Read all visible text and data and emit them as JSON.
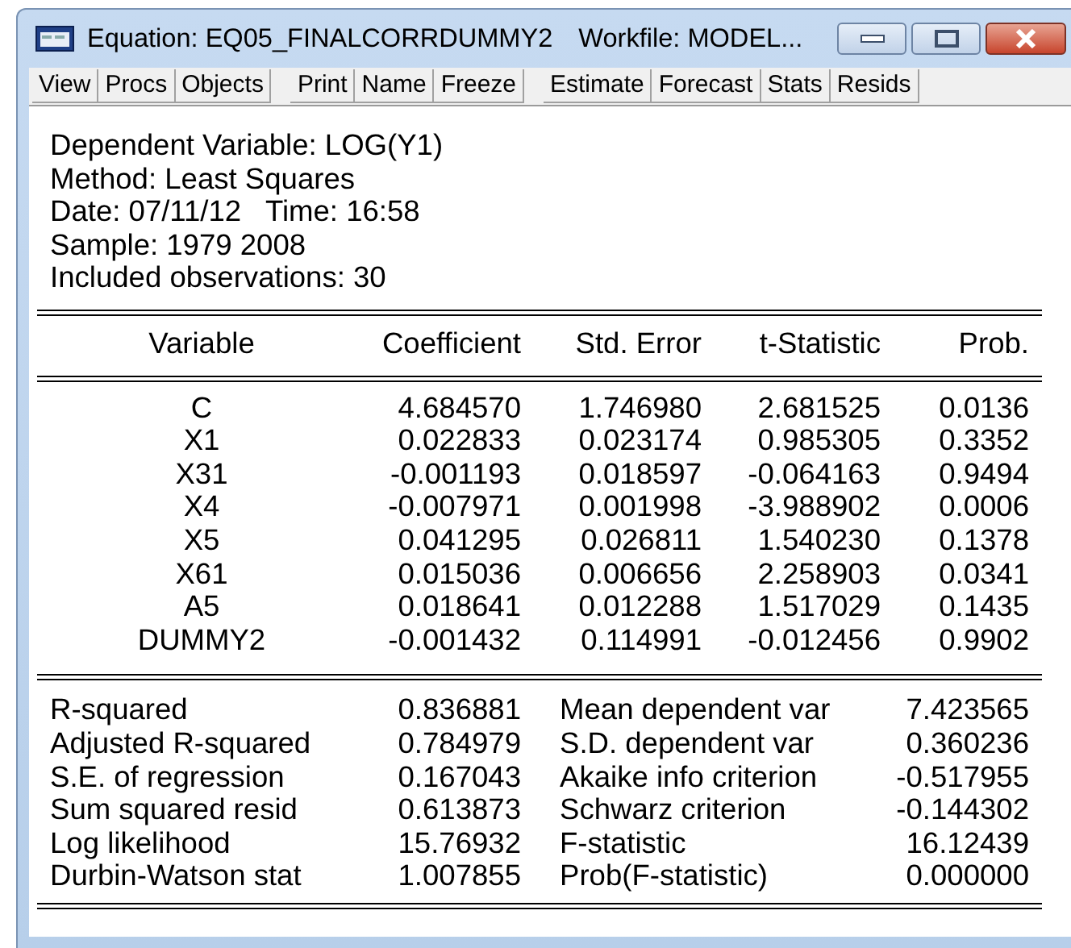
{
  "window": {
    "title": "Equation: EQ05_FINALCORRDUMMY2",
    "workfile": "Workfile: MODEL..."
  },
  "toolbar": [
    [
      "View",
      "Procs",
      "Objects"
    ],
    [
      "Print",
      "Name",
      "Freeze"
    ],
    [
      "Estimate",
      "Forecast",
      "Stats",
      "Resids"
    ]
  ],
  "header_lines": [
    "Dependent Variable: LOG(Y1)",
    "Method: Least Squares",
    "Date: 07/11/12   Time: 16:58",
    "Sample: 1979 2008",
    "Included observations: 30"
  ],
  "coef_table": {
    "columns": [
      "Variable",
      "Coefficient",
      "Std. Error",
      "t-Statistic",
      "Prob."
    ],
    "rows": [
      [
        "C",
        "4.684570",
        "1.746980",
        "2.681525",
        "0.0136"
      ],
      [
        "X1",
        "0.022833",
        "0.023174",
        "0.985305",
        "0.3352"
      ],
      [
        "X31",
        "-0.001193",
        "0.018597",
        "-0.064163",
        "0.9494"
      ],
      [
        "X4",
        "-0.007971",
        "0.001998",
        "-3.988902",
        "0.0006"
      ],
      [
        "X5",
        "0.041295",
        "0.026811",
        "1.540230",
        "0.1378"
      ],
      [
        "X61",
        "0.015036",
        "0.006656",
        "2.258903",
        "0.0341"
      ],
      [
        "A5",
        "0.018641",
        "0.012288",
        "1.517029",
        "0.1435"
      ],
      [
        "DUMMY2",
        "-0.001432",
        "0.114991",
        "-0.012456",
        "0.9902"
      ]
    ]
  },
  "summary_stats": [
    [
      "R-squared",
      "0.836881",
      "Mean dependent var",
      "7.423565"
    ],
    [
      "Adjusted R-squared",
      "0.784979",
      "S.D. dependent var",
      "0.360236"
    ],
    [
      "S.E. of regression",
      "0.167043",
      "Akaike info criterion",
      "-0.517955"
    ],
    [
      "Sum squared resid",
      "0.613873",
      "Schwarz criterion",
      "-0.144302"
    ],
    [
      "Log likelihood",
      "15.76932",
      "F-statistic",
      "16.12439"
    ],
    [
      "Durbin-Watson stat",
      "1.007855",
      "Prob(F-statistic)",
      "0.000000"
    ]
  ]
}
